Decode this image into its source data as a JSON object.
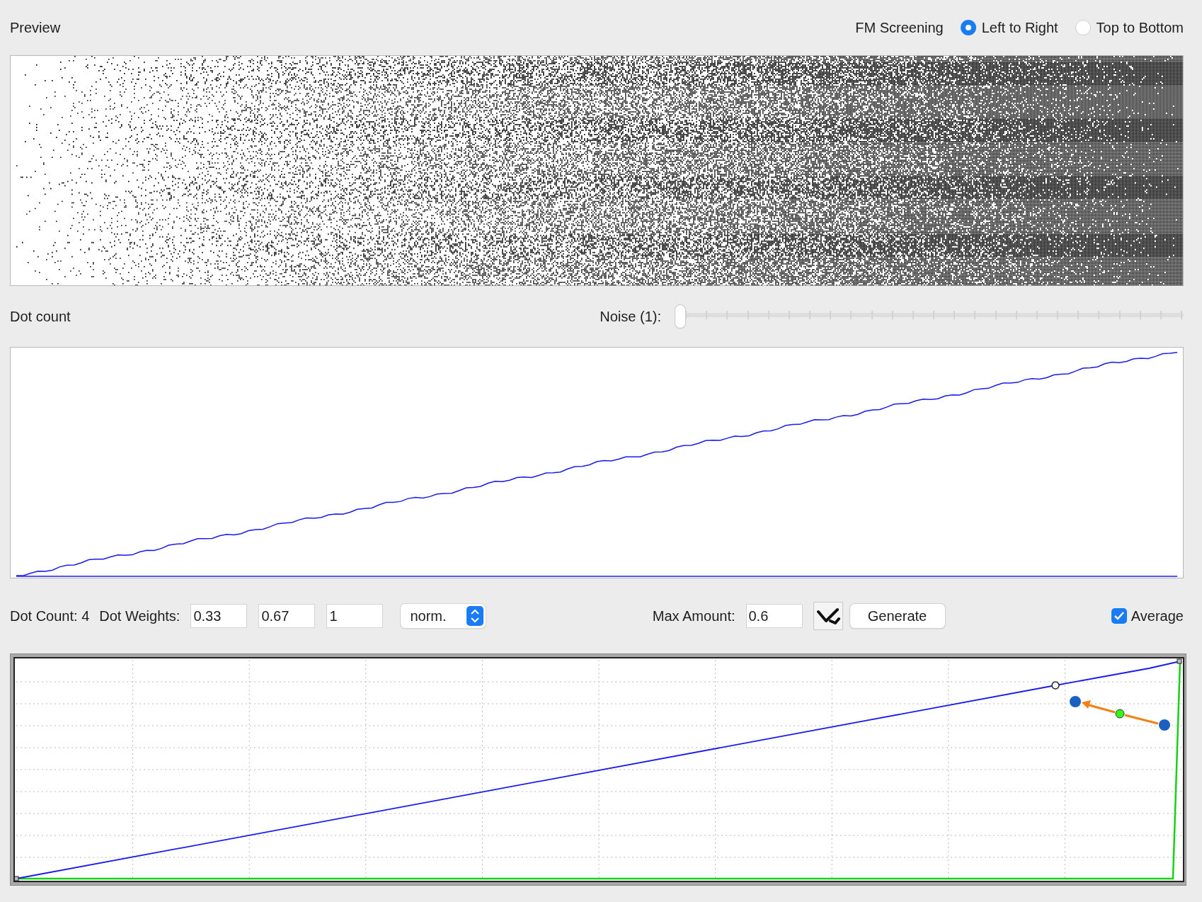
{
  "preview": {
    "title": "Preview",
    "mode_label": "FM Screening",
    "directions": [
      {
        "label": "Left to Right",
        "selected": true
      },
      {
        "label": "Top to Bottom",
        "selected": false
      }
    ]
  },
  "dot_count": {
    "title": "Dot count",
    "noise": {
      "label": "Noise (1):",
      "level": 0
    }
  },
  "controls": {
    "dot_count": "Dot Count: 4",
    "weights_label": "Dot Weights:",
    "weights": [
      "0.33",
      "0.67",
      "1"
    ],
    "mode": "norm.",
    "max_amount_label": "Max Amount:",
    "max_amount": "0.6",
    "generate": "Generate",
    "average": {
      "label": "Average",
      "checked": true
    }
  }
}
